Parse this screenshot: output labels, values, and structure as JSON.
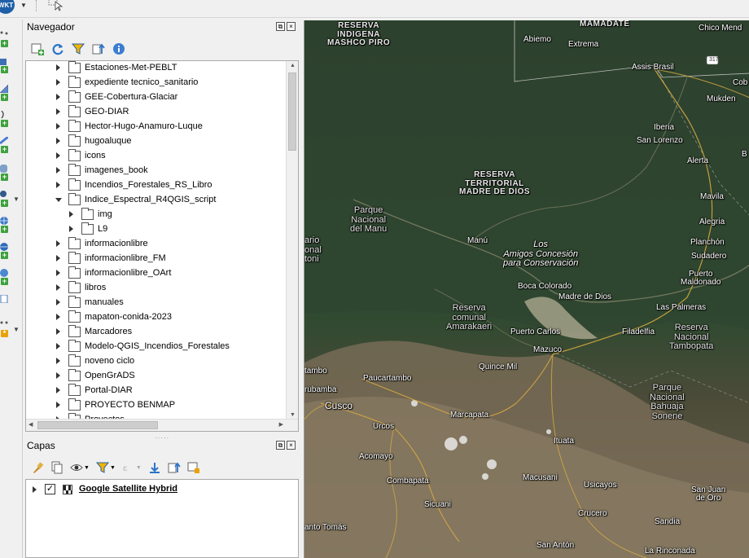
{
  "toolbar": {
    "wkt_label": "WKT"
  },
  "navigator": {
    "title": "Navegador",
    "items": [
      {
        "label": "Estaciones-Met-PEBLT"
      },
      {
        "label": "expediente tecnico_sanitario"
      },
      {
        "label": "GEE-Cobertura-Glaciar"
      },
      {
        "label": "GEO-DIAR"
      },
      {
        "label": "Hector-Hugo-Anamuro-Luque"
      },
      {
        "label": "hugoaluque"
      },
      {
        "label": "icons"
      },
      {
        "label": "imagenes_book"
      },
      {
        "label": "Incendios_Forestales_RS_Libro"
      },
      {
        "label": "Indice_Espectral_R4QGIS_script"
      },
      {
        "label": "img"
      },
      {
        "label": "L9"
      },
      {
        "label": "informacionlibre"
      },
      {
        "label": "informacionlibre_FM"
      },
      {
        "label": "informacionlibre_OArt"
      },
      {
        "label": "libros"
      },
      {
        "label": "manuales"
      },
      {
        "label": "mapaton-conida-2023"
      },
      {
        "label": "Marcadores"
      },
      {
        "label": "Modelo-QGIS_Incendios_Forestales"
      },
      {
        "label": "noveno ciclo"
      },
      {
        "label": "OpenGrADS"
      },
      {
        "label": "Portal-DIAR"
      },
      {
        "label": "PROYECTO BENMAP"
      },
      {
        "label": "Proyectos"
      }
    ]
  },
  "layers": {
    "title": "Capas",
    "items": [
      {
        "label": "Google Satellite Hybrid",
        "checked": true
      }
    ]
  },
  "map": {
    "labels": {
      "reserva_indigena": "RESERVA\nINDIGENA\nMASHCO PIRO",
      "mamadate": "MAMADATE",
      "chico_mendes": "Chico Mend",
      "abiemo": "Abiemo",
      "extrema": "Extrema",
      "assis_brasil": "Assis Brasil",
      "road_317": "317",
      "cob": "Cob",
      "mukden": "Mukden",
      "iberia": "Iberia",
      "san_lorenzo": "San Lorenzo",
      "alerta": "Alerta",
      "b": "B",
      "reserva_territorial": "RESERVA\nTERRITORIAL\nMADRE DE DIOS",
      "mavila": "Mavila",
      "parque_manu": "Parque\nNacional\ndel Manu",
      "alegria": "Alegria",
      "ario": "ario\nonal\ntoni",
      "manu": "Manú",
      "los_amigos": "Los\nAmigos Concesión\npara Conservación",
      "planchon": "Planchón",
      "sudadero": "Sudadero",
      "puerto_maldonado": "Puerto\nMaldonado",
      "boca_colorado": "Boca Colorado",
      "madre_de_dios": "Madre de Dios",
      "las_palmeras": "Las Palmeras",
      "reserva_amarakaeri": "Reserva\ncomunal\nAmarakaeri",
      "puerto_carlos": "Puerto Carlos",
      "filadelfia": "Filadelfia",
      "reserva_tambopata": "Reserva\nNacional\nTambopata",
      "mazuco": "Mazuco",
      "quince_mil": "Quince Mil",
      "tambo": "tambo",
      "paucartambo": "Paucartambo",
      "urubamba": "rubamba",
      "parque_bahuaja": "Parque\nNacional\nBahuaja\nSonene",
      "cusco": "Cusco",
      "marcapata": "Marcapata",
      "urcos": "Urcos",
      "ituata": "Ituata",
      "acomayo": "Acomayo",
      "combapata": "Combapata",
      "macusani": "Macusani",
      "usicayos": "Usicayos",
      "sicuani": "Sicuani",
      "crucero": "Crucero",
      "san_juan_oro": "San Juan\nde Oro",
      "santo_tomas": "anto Tomás",
      "sandia": "Sandia",
      "san_anton": "San Antón",
      "la_rinconada": "La Rinconada"
    }
  }
}
